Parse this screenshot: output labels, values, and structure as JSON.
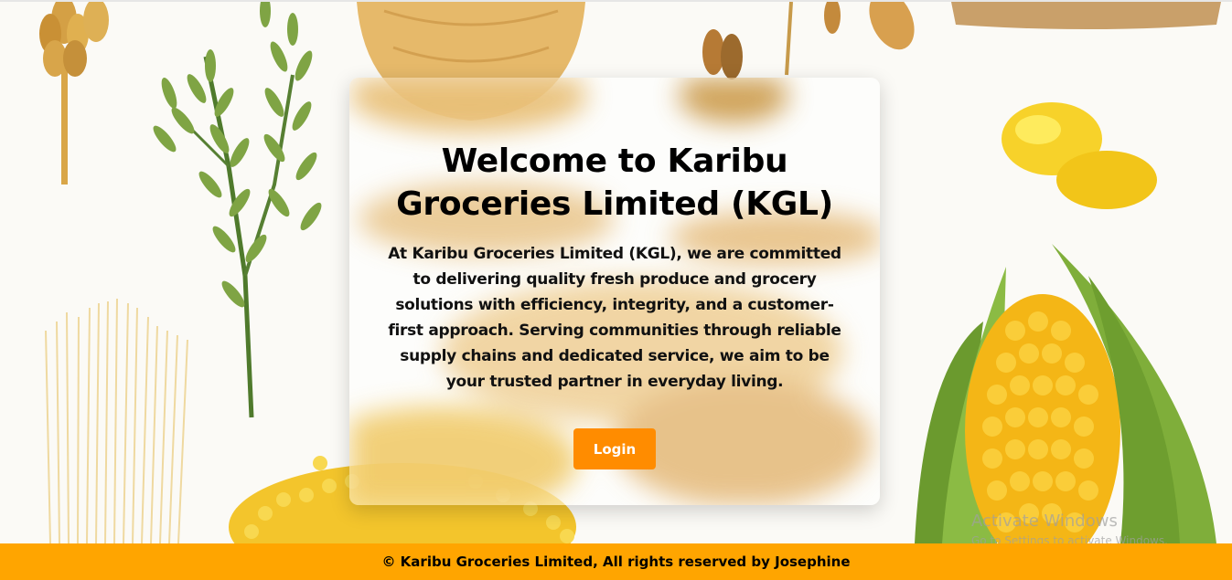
{
  "hero": {
    "title": "Welcome to Karibu Groceries Limited (KGL)",
    "description": "At Karibu Groceries Limited (KGL), we are committed to delivering quality fresh produce and grocery solutions with efficiency, integrity, and a customer-first approach. Serving communities through reliable supply chains and dedicated service, we aim to be your trusted partner in everyday living.",
    "login_label": "Login"
  },
  "footer": {
    "text": "© Karibu Groceries Limited, All rights reserved by Josephine"
  },
  "watermark": {
    "title": "Activate Windows",
    "subtitle": "Go to Settings to activate Windows."
  },
  "colors": {
    "accent_button": "#ff8c00",
    "footer_bg": "#ffa500",
    "text": "#000000"
  },
  "background_images": [
    "wheat-ear-icon",
    "rice-stalk-icon",
    "wooden-bowl-icon",
    "oat-icon",
    "grain-sack-icon",
    "corn-kernels-icon",
    "corn-cob-icon",
    "spaghetti-icon",
    "corn-grits-icon"
  ]
}
